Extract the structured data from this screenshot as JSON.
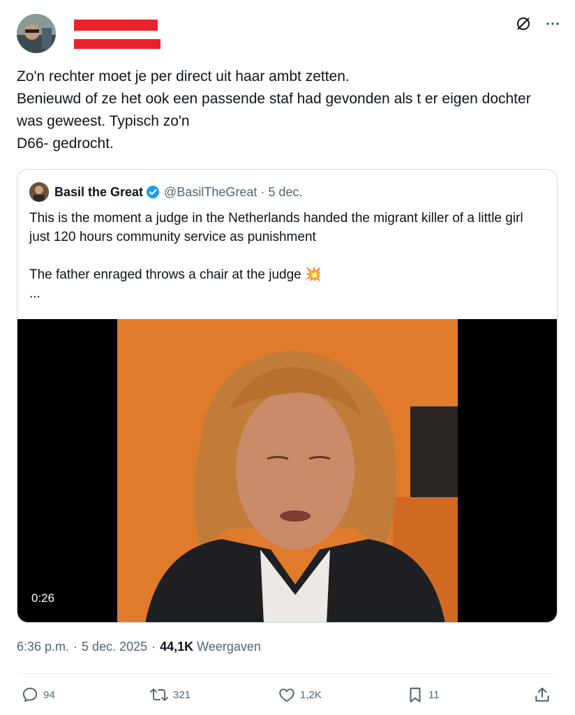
{
  "tweet": {
    "text": "Zo'n rechter moet je per direct uit haar ambt zetten.\nBenieuwd of ze het ook een passende staf had gevonden als t er eigen dochter was geweest. Typisch zo'n\nD66- gedrocht.",
    "icons": {
      "grok": "grok-icon",
      "more": "more-dots-icon"
    }
  },
  "quote": {
    "name": "Basil the Great",
    "handle": "@BasilTheGreat",
    "separator": "·",
    "date": "5 dec.",
    "paragraph1": "This is the moment a judge in the Netherlands handed the migrant killer of a little girl just 120 hours community service as punishment",
    "paragraph2": "The father enraged throws a chair at the judge 💥",
    "ellipsis": "...",
    "video_duration": "0:26"
  },
  "meta": {
    "time": "6:36 p.m.",
    "dot1": "·",
    "date": "5 dec. 2025",
    "dot2": "·",
    "views_count": "44,1K",
    "views_label": "Weergaven"
  },
  "actions": {
    "replies": "94",
    "reposts": "321",
    "likes": "1,2K",
    "bookmarks": "11"
  },
  "colors": {
    "text": "#0f1419",
    "secondary": "#536471",
    "border": "#cfd9de",
    "verified": "#1d9bf0",
    "redaction": "#e8222b"
  }
}
